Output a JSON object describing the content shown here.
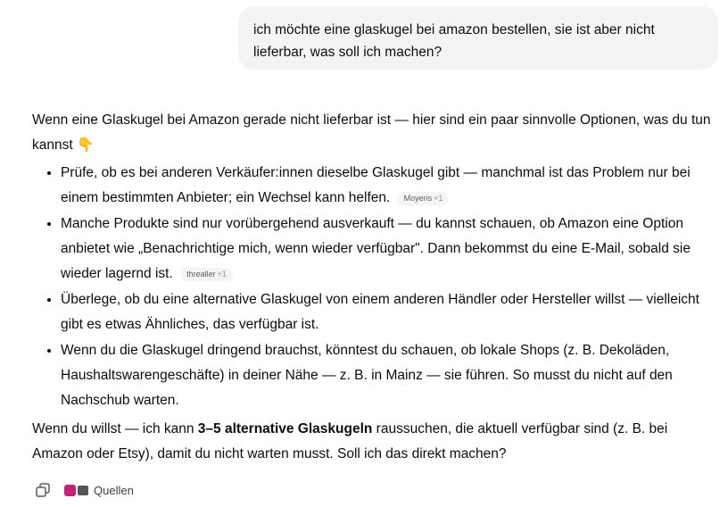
{
  "user_message": "ich möchte eine glaskugel bei amazon bestellen, sie ist aber nicht lieferbar, was soll ich machen?",
  "assistant": {
    "intro": "Wenn eine Glaskugel bei Amazon gerade nicht lieferbar ist — hier sind ein paar sinnvolle Optionen, was du tun kannst 👇",
    "bullets": [
      {
        "text": "Prüfe, ob es bei anderen Verkäufer:innen dieselbe Glaskugel gibt — manchmal ist das Problem nur bei einem bestimmten Anbieter; ein Wechsel kann helfen.",
        "source": "Moyens",
        "source_more": "+1"
      },
      {
        "text": "Manche Produkte sind nur vorübergehend ausverkauft — du kannst schauen, ob Amazon eine Option anbietet wie „Benachrichtige mich, wenn wieder verfügbar\". Dann bekommst du eine E-Mail, sobald sie wieder lagernd ist.",
        "source": "threaller",
        "source_more": "+1"
      },
      {
        "text": "Überlege, ob du eine alternative Glaskugel von einem anderen Händler oder Hersteller willst — vielleicht gibt es etwas Ähnliches, das verfügbar ist."
      },
      {
        "text": "Wenn du die Glaskugel dringend brauchst, könntest du schauen, ob lokale Shops (z. B. Dekoläden, Haushaltswarengeschäfte) in deiner Nähe — z. B. in Mainz — sie führen. So musst du nicht auf den Nachschub warten."
      }
    ],
    "outro_before": "Wenn du willst — ich kann ",
    "outro_bold": "3–5 alternative Glaskugeln",
    "outro_after": " raussuchen, die aktuell verfügbar sind (z. B. bei Amazon oder Etsy), damit du nicht warten musst. Soll ich das direkt machen?"
  },
  "actions": {
    "copy_icon": "copy-icon",
    "sources_label": "Quellen"
  },
  "colors": {
    "user_bubble_bg": "#f4f4f4",
    "source_chip_bg": "#f4f4f4",
    "text": "#0d0d0d"
  }
}
